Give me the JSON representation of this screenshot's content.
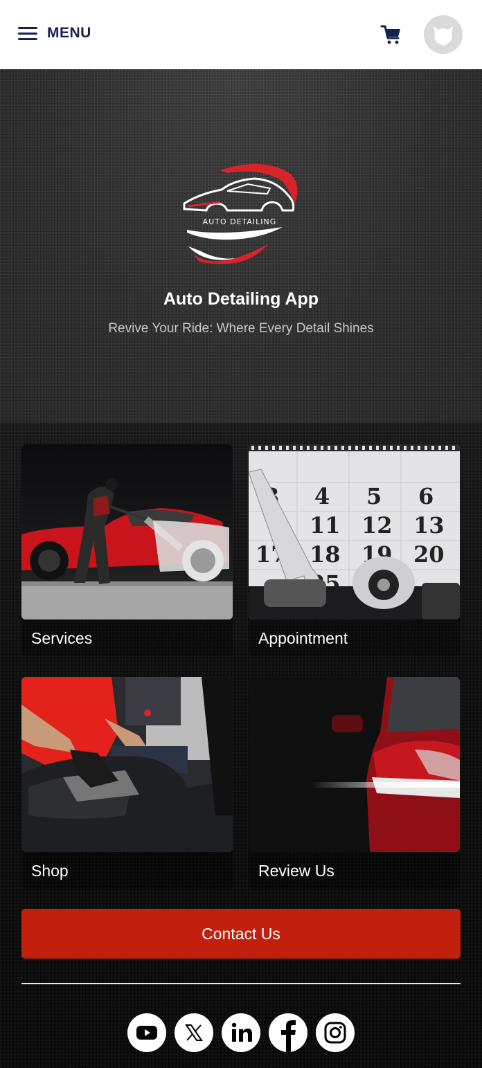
{
  "header": {
    "menu_label": "MENU",
    "icons": {
      "menu": "hamburger-icon",
      "cart": "cart-icon",
      "avatar": "user-avatar-icon"
    },
    "brand_color": "#16214f"
  },
  "hero": {
    "logo_text": "AUTO DETAILING",
    "title": "Auto Detailing App",
    "subtitle": "Revive Your Ride: Where Every Detail Shines"
  },
  "tiles": [
    {
      "label": "Services",
      "image": "car-foam-wash-photo"
    },
    {
      "label": "Appointment",
      "image": "calendar-with-wrench-photo"
    },
    {
      "label": "Shop",
      "image": "interior-seat-cleaning-photo"
    },
    {
      "label": "Review Us",
      "image": "red-car-headlight-photo"
    }
  ],
  "contact": {
    "label": "Contact Us",
    "color": "#c0200d"
  },
  "social": [
    {
      "name": "YouTube",
      "icon": "youtube-icon"
    },
    {
      "name": "X",
      "icon": "x-twitter-icon"
    },
    {
      "name": "LinkedIn",
      "icon": "linkedin-icon"
    },
    {
      "name": "Facebook",
      "icon": "facebook-icon"
    },
    {
      "name": "Instagram",
      "icon": "instagram-icon"
    }
  ]
}
